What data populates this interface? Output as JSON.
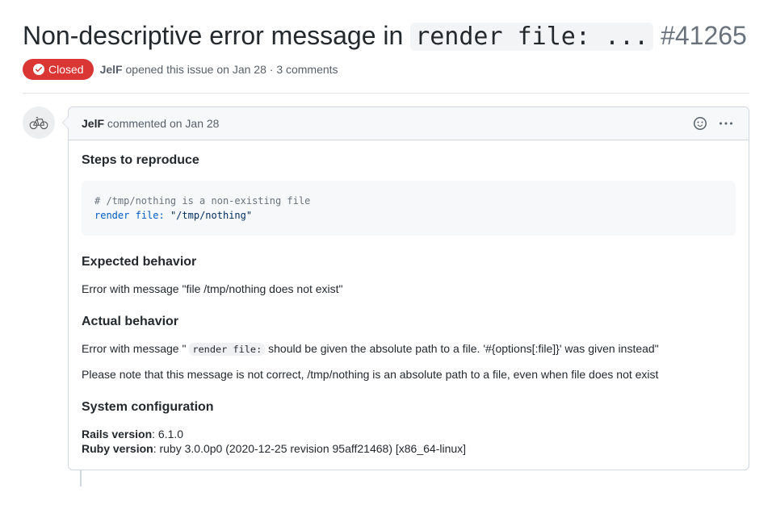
{
  "issue": {
    "title_prefix": "Non-descriptive error message in ",
    "title_code": "render file: ...",
    "number": "#41265"
  },
  "state": {
    "label": "Closed"
  },
  "meta": {
    "author": "JelF",
    "opened_text": " opened this issue ",
    "date": "on Jan 28",
    "separator": " · ",
    "comments": "3 comments"
  },
  "comment": {
    "author": "JelF",
    "commented": " commented ",
    "date": "on Jan 28"
  },
  "body": {
    "h_steps": "Steps to reproduce",
    "code_comment": "# /tmp/nothing is a non-existing file",
    "code_kw1": "render",
    "code_kw2": "file:",
    "code_str": "\"/tmp/nothing\"",
    "h_expected": "Expected behavior",
    "expected_text": "Error with message \"file /tmp/nothing does not exist\"",
    "h_actual": "Actual behavior",
    "actual_pre": "Error with message \" ",
    "actual_code": "render file:",
    "actual_post": " should be given the absolute path to a file. '#{options[:file]}' was given instead\"",
    "note": "Please note that this message is not correct, /tmp/nothing is an absolute path to a file, even when file does not exist",
    "h_sys": "System configuration",
    "rails_label": "Rails version",
    "rails_val": ": 6.1.0",
    "ruby_label": "Ruby version",
    "ruby_val": ": ruby 3.0.0p0 (2020-12-25 revision 95aff21468) [x86_64-linux]"
  }
}
